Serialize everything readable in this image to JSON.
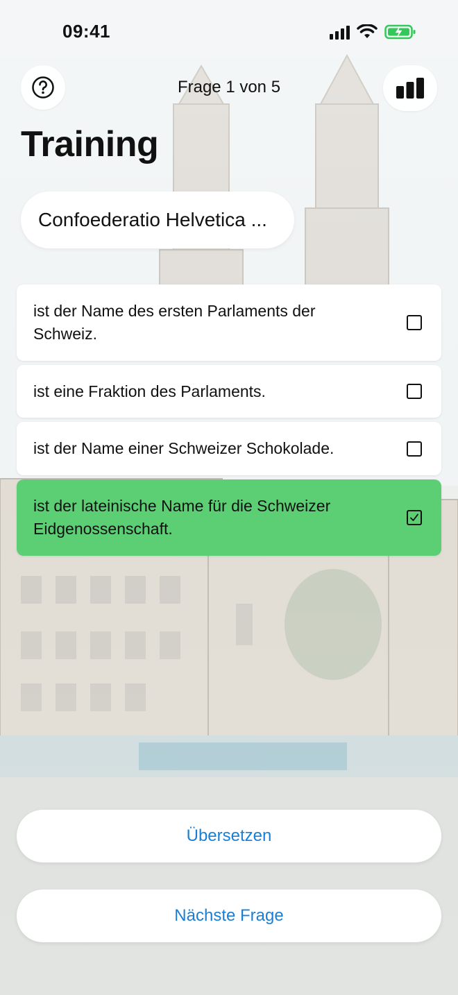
{
  "status_bar": {
    "time": "09:41"
  },
  "nav": {
    "progress_label": "Frage 1 von 5",
    "help_icon": "question-circle-icon",
    "stats_icon": "bar-chart-icon"
  },
  "title": "Training",
  "question": {
    "text": "Confoederatio Helvetica ..."
  },
  "answers": [
    {
      "label": "ist der Name des ersten Parlaments der Schweiz.",
      "selected": false
    },
    {
      "label": "ist eine Fraktion des Parlaments.",
      "selected": false
    },
    {
      "label": "ist der Name einer Schweizer Schokolade.",
      "selected": false
    },
    {
      "label": "ist der lateinische Name für die Schweizer Eidgenossenschaft.",
      "selected": true
    }
  ],
  "buttons": {
    "translate": "Übersetzen",
    "next": "Nächste Frage"
  },
  "colors": {
    "selected_answer": "#5ccf74",
    "button_text": "#1a7fd4",
    "battery": "#34c759"
  }
}
